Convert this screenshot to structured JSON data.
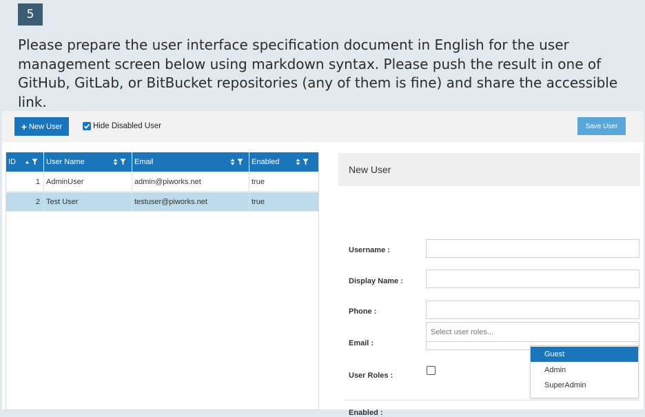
{
  "task": {
    "number": "5",
    "text": "Please prepare the user interface specification document in English for the user management screen below using markdown syntax. Please push the result in one of GitHub, GitLab, or BitBucket repositories (any of them is fine) and share the accessible link."
  },
  "colors": {
    "primary": "#1b75bb",
    "save_button": "#5aa6d8",
    "selected_row": "#bcdcec",
    "badge": "#3d5c73"
  },
  "toolbar": {
    "new_user_label": "New User",
    "new_user_icon": "plus-icon",
    "hide_disabled_label": "Hide Disabled User",
    "hide_disabled_checked": true,
    "save_user_label": "Save User"
  },
  "grid": {
    "columns": [
      {
        "label": "ID",
        "icons": [
          "sort-asc-icon",
          "filter-icon"
        ]
      },
      {
        "label": "User Name",
        "icons": [
          "sort-icon",
          "filter-icon"
        ]
      },
      {
        "label": "Email",
        "icons": [
          "sort-icon",
          "filter-icon"
        ]
      },
      {
        "label": "Enabled",
        "icons": [
          "sort-icon",
          "filter-icon"
        ]
      }
    ],
    "rows": [
      {
        "id": "1",
        "username": "AdminUser",
        "email": "admin@piworks.net",
        "enabled": "true",
        "selected": false
      },
      {
        "id": "2",
        "username": "Test User",
        "email": "testuser@piworks.net",
        "enabled": "true",
        "selected": true
      }
    ]
  },
  "form": {
    "title": "New User",
    "username_label": "Username :",
    "display_name_label": "Display Name :",
    "phone_label": "Phone :",
    "email_label": "Email :",
    "roles_label": "User Roles :",
    "roles_placeholder": "Select user roles...",
    "enabled_label": "Enabled :",
    "enabled_checked": false,
    "role_options": [
      "Guest",
      "Admin",
      "SuperAdmin"
    ],
    "role_highlighted": "Guest"
  }
}
